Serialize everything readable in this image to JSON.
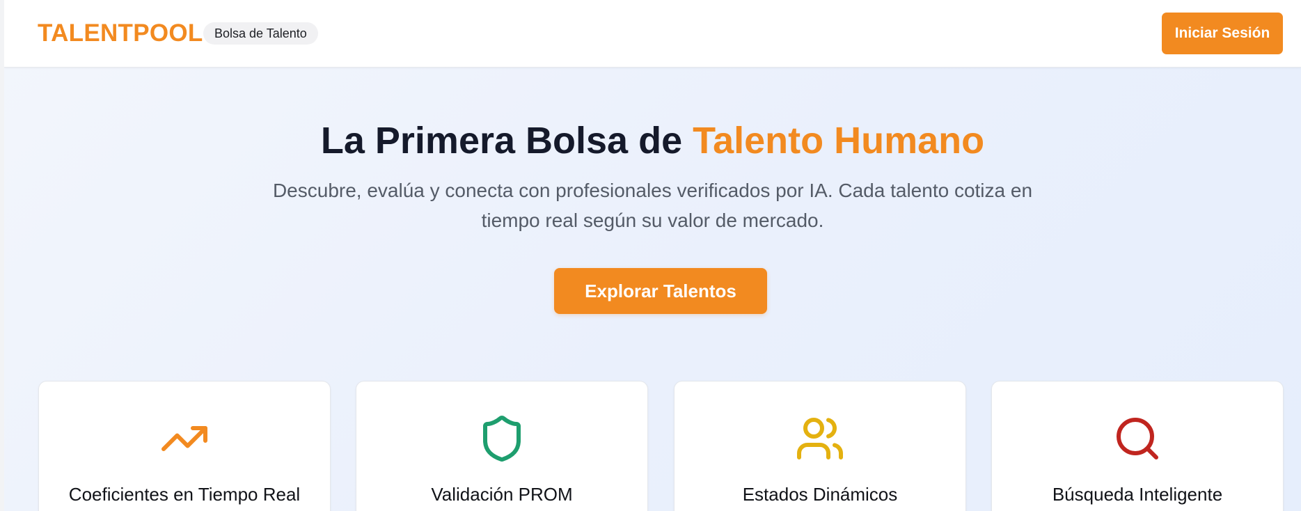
{
  "navbar": {
    "brand": "TALENTPOOL",
    "badge": "Bolsa de Talento",
    "login_label": "Iniciar Sesión"
  },
  "hero": {
    "title_main": "La Primera Bolsa de ",
    "title_accent": "Talento Humano",
    "subtitle": "Descubre, evalúa y conecta con profesionales verificados por IA. Cada talento cotiza en tiempo real según su valor de mercado.",
    "cta_label": "Explorar Talentos"
  },
  "features": [
    {
      "title": "Coeficientes en Tiempo Real",
      "icon": "trending-up-icon",
      "color": "#f28a20"
    },
    {
      "title": "Validación PROM",
      "icon": "shield-icon",
      "color": "#1e9e6e"
    },
    {
      "title": "Estados Dinámicos",
      "icon": "users-icon",
      "color": "#e4b110"
    },
    {
      "title": "Búsqueda Inteligente",
      "icon": "search-icon",
      "color": "#c0251f"
    }
  ],
  "colors": {
    "accent": "#f28a20",
    "title_text": "#151a2b",
    "subtitle_text": "#545b67",
    "background": "#eaf0fc"
  }
}
